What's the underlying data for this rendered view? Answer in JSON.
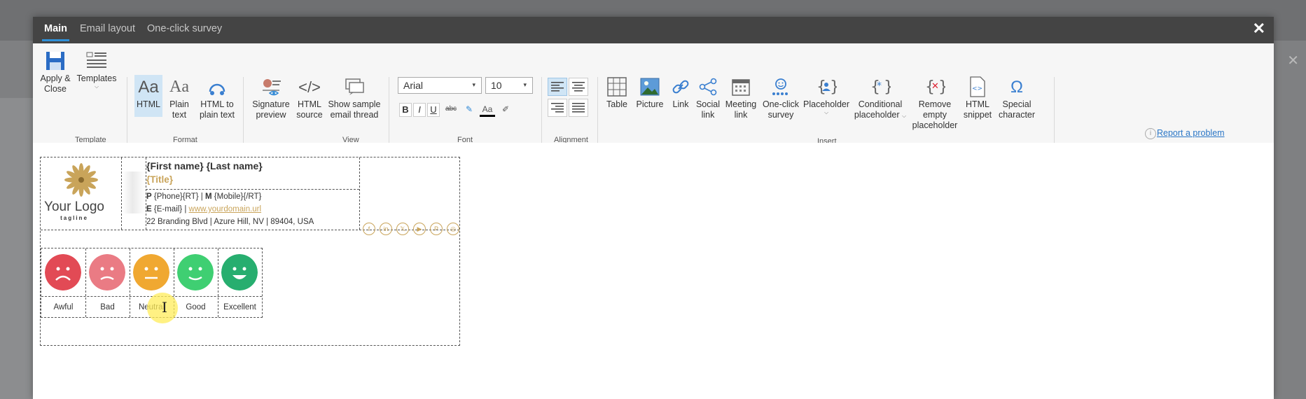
{
  "tabs": [
    {
      "label": "Main",
      "active": true
    },
    {
      "label": "Email layout",
      "active": false
    },
    {
      "label": "One-click survey",
      "active": false
    }
  ],
  "template_group": {
    "label": "Template",
    "apply_close": "Apply & Close",
    "templates": "Templates"
  },
  "format_group": {
    "label": "Format",
    "html": "HTML",
    "plain_text": "Plain text",
    "html_to_plain": "HTML to plain text"
  },
  "view_group": {
    "label": "View",
    "signature_preview": "Signature preview",
    "html_source": "HTML source",
    "show_thread": "Show sample email thread"
  },
  "font_group": {
    "label": "Font",
    "font_name": "Arial",
    "font_size": "10",
    "bold": "B",
    "italic": "I",
    "underline": "U",
    "strike": "abc",
    "font_color": "Aa"
  },
  "alignment_group": {
    "label": "Alignment"
  },
  "insert_group": {
    "label": "Insert",
    "table": "Table",
    "picture": "Picture",
    "link": "Link",
    "social_link": "Social link",
    "meeting_link": "Meeting link",
    "one_click_survey": "One-click survey",
    "placeholder": "Placeholder",
    "conditional_placeholder": "Conditional placeholder",
    "remove_empty_placeholder": "Remove empty placeholder",
    "html_snippet": "HTML snippet",
    "special_character": "Special character"
  },
  "report_link": "Report a problem",
  "signature": {
    "logo_text": "Your Logo",
    "logo_tagline": "tagline",
    "name": "{First name} {Last name}",
    "title": "{Title}",
    "line1_p_label": "P",
    "line1_p_value": "{Phone}{RT} | ",
    "line1_m_label": "M",
    "line1_m_value": "{Mobile}{/RT}",
    "line2_e_label": "E",
    "line2_e_value": "{E-mail} | ",
    "line2_url": "www.yourdomain.url",
    "line3": "22 Branding Blvd | Azure Hill, NV | 89404, USA",
    "social_icons": [
      "facebook-icon",
      "linkedin-icon",
      "x-icon",
      "youtube-icon",
      "pinterest-icon",
      "instagram-icon"
    ]
  },
  "survey": {
    "options": [
      {
        "label": "Awful",
        "color": "#e24a55"
      },
      {
        "label": "Bad",
        "color": "#ea7b84"
      },
      {
        "label": "Neutral",
        "color": "#f0a831"
      },
      {
        "label": "Good",
        "color": "#3fcf72"
      },
      {
        "label": "Excellent",
        "color": "#27ae6f"
      }
    ]
  },
  "colors": {
    "accent": "#2f90d8",
    "gold": "#c9a45a",
    "titlebar": "#444444"
  }
}
